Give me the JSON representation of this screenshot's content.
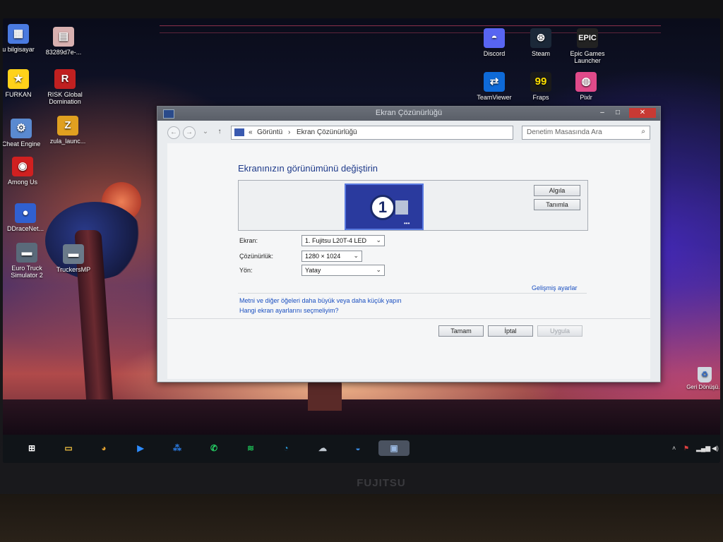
{
  "monitor": {
    "brand": "FUJITSU"
  },
  "desktop_icons": [
    {
      "label": "u bilgisayar",
      "glyph": "▦",
      "color": "#4a7ae0"
    },
    {
      "label": "83289d7e-...",
      "glyph": "▤",
      "color": "#d8b0b0"
    },
    {
      "label": "FURKAN",
      "glyph": "★",
      "color": "#ffd21a"
    },
    {
      "label": "RISK Global Domination",
      "glyph": "R",
      "color": "#c02020"
    },
    {
      "label": "Cheat Engine",
      "glyph": "⚙",
      "color": "#5a8ad0"
    },
    {
      "label": "zula_launc...",
      "glyph": "Z",
      "color": "#e0a020"
    },
    {
      "label": "Among Us",
      "glyph": "◉",
      "color": "#d02020"
    },
    {
      "label": "DDraceNet...",
      "glyph": "●",
      "color": "#3060d0"
    },
    {
      "label": "Euro Truck Simulator 2",
      "glyph": "▬",
      "color": "#5a6a7a"
    },
    {
      "label": "TruckersMP",
      "glyph": "▬",
      "color": "#6a7a8a"
    },
    {
      "label": "Discord",
      "glyph": "◓",
      "color": "#5865f2"
    },
    {
      "label": "Steam",
      "glyph": "⊛",
      "color": "#1b2838"
    },
    {
      "label": "Epic Games Launcher",
      "glyph": "EPIC",
      "color": "#222222"
    },
    {
      "label": "TeamViewer",
      "glyph": "⇄",
      "color": "#0e6ad8"
    },
    {
      "label": "Fraps",
      "glyph": "99",
      "color": "#1a1a1a"
    },
    {
      "label": "Pixlr",
      "glyph": "◍",
      "color": "#e04a8a"
    }
  ],
  "recycle_bin": {
    "label": "Geri Dönüşü..."
  },
  "window": {
    "title": "Ekran Çözünürlüğü",
    "address": {
      "crumb1": "Görüntü",
      "crumb2": "Ekran Çözünürlüğü",
      "prefix": "«",
      "sep": "›"
    },
    "search_placeholder": "Denetim Masasında Ara",
    "heading": "Ekranınızın görünümünü değiştirin",
    "monitor_number": "1",
    "buttons": {
      "detect": "Algıla",
      "identify": "Tanımla"
    },
    "fields": {
      "display_label": "Ekran:",
      "display_value": "1. Fujitsu L20T-4 LED",
      "resolution_label": "Çözünürlük:",
      "resolution_value": "1280 × 1024",
      "orientation_label": "Yön:",
      "orientation_value": "Yatay"
    },
    "advanced_link": "Gelişmiş ayarlar",
    "links": [
      "Metni ve diğer öğeleri daha büyük veya daha küçük yapın",
      "Hangi ekran ayarlarını seçmeliyim?"
    ],
    "actions": {
      "ok": "Tamam",
      "cancel": "İptal",
      "apply": "Uygula"
    }
  },
  "taskbar": {
    "apps": [
      {
        "name": "start",
        "glyph": "⊞",
        "color": "#ffffff"
      },
      {
        "name": "file-explorer",
        "glyph": "▭",
        "color": "#f0c040"
      },
      {
        "name": "chrome",
        "glyph": "◕",
        "color": "#e0a030"
      },
      {
        "name": "zoom",
        "glyph": "▶",
        "color": "#2d8cff"
      },
      {
        "name": "blackberry",
        "glyph": "⁂",
        "color": "#2a7ae0"
      },
      {
        "name": "whatsapp",
        "glyph": "✆",
        "color": "#25d366"
      },
      {
        "name": "spotify",
        "glyph": "≋",
        "color": "#1db954"
      },
      {
        "name": "edge",
        "glyph": "◔",
        "color": "#2a9ad8"
      },
      {
        "name": "app-cloud",
        "glyph": "☁",
        "color": "#c0c8d0"
      },
      {
        "name": "app-globe",
        "glyph": "◒",
        "color": "#3a8ae0"
      },
      {
        "name": "display-settings",
        "glyph": "▣",
        "color": "#9ab8e0"
      }
    ]
  }
}
